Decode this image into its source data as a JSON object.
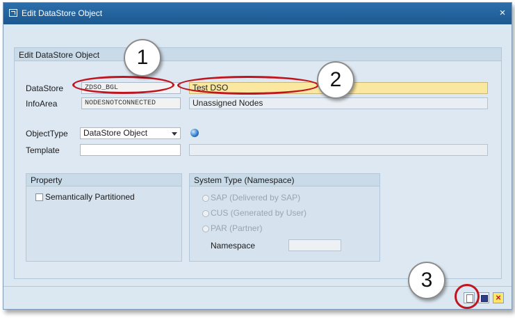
{
  "window": {
    "title": "Edit DataStore Object",
    "close_glyph": "×"
  },
  "group": {
    "header": "Edit DataStore Object"
  },
  "fields": {
    "datastore": {
      "label": "DataStore",
      "value": "ZDSO_BGL",
      "description": "Test DSO"
    },
    "infoarea": {
      "label": "InfoArea",
      "value": "NODESNOTCONNECTED",
      "description": "Unassigned Nodes"
    },
    "objecttype": {
      "label": "ObjectType",
      "value": "DataStore Object"
    },
    "template": {
      "label": "Template",
      "value": "",
      "description": ""
    }
  },
  "property": {
    "header": "Property",
    "semantically_partitioned": {
      "label": "Semantically Partitioned",
      "checked": false
    }
  },
  "system_type": {
    "header": "System Type (Namespace)",
    "options": [
      {
        "label": "SAP (Delivered by SAP)",
        "selected": false
      },
      {
        "label": "CUS (Generated by User)",
        "selected": false
      },
      {
        "label": "PAR (Partner)",
        "selected": false
      }
    ],
    "namespace_label": "Namespace",
    "namespace_value": ""
  },
  "toolbar": {
    "new_icon": "new-document-icon",
    "save_icon": "save-icon",
    "cancel_glyph": "×"
  },
  "callouts": [
    "1",
    "2",
    "3"
  ],
  "colors": {
    "titlebar": "#1d5890",
    "highlight_field": "#fbe8a0",
    "callout_ring": "#c0141f"
  }
}
